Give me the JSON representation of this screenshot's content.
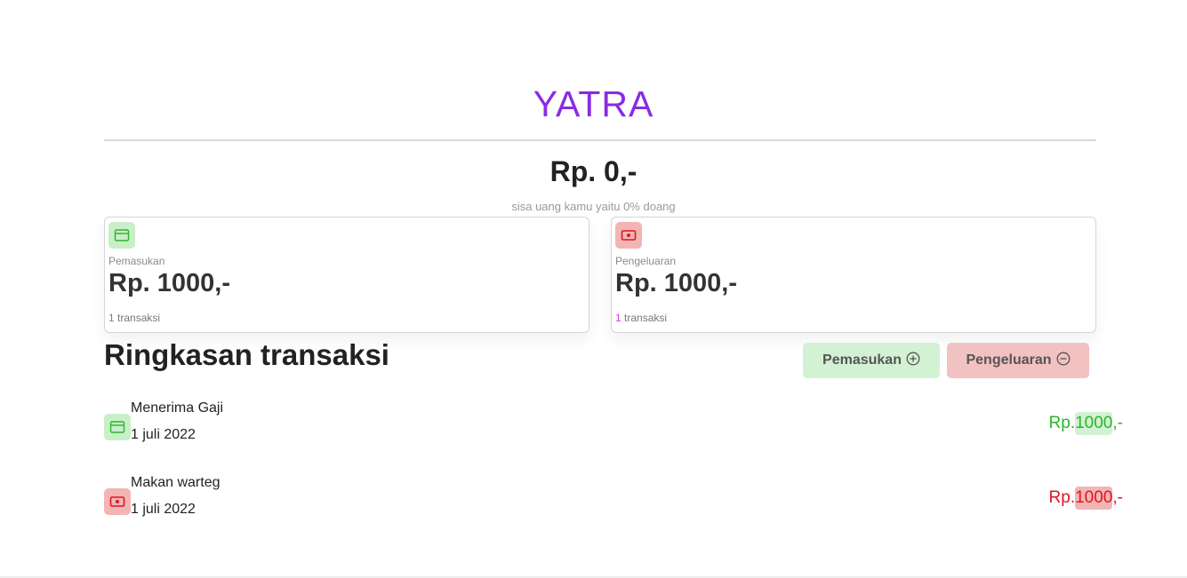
{
  "app": {
    "brand": "YATRA"
  },
  "summary": {
    "balance": "Rp. 0,-",
    "subtext": "sisa uang kamu yaitu 0% doang"
  },
  "cards": {
    "income": {
      "label": "Pemasukan",
      "amount": "Rp. 1000,-",
      "count": "1",
      "count_suffix": "transaksi",
      "icon": "wallet-icon"
    },
    "expense": {
      "label": "Pengeluaran",
      "amount": "Rp. 1000,-",
      "count": "1",
      "count_suffix": "transaksi",
      "icon": "cash-icon"
    }
  },
  "section": {
    "title": "Ringkasan transaksi"
  },
  "actions": {
    "add_income": "Pemasukan",
    "add_expense": "Pengeluaran"
  },
  "transactions": [
    {
      "name": "Menerima Gaji",
      "date": "1 juli 2022",
      "prefix": "Rp.",
      "amount": "1000",
      "suffix": ",-",
      "type": "income",
      "icon": "wallet-icon"
    },
    {
      "name": "Makan warteg",
      "date": "1 juli 2022",
      "prefix": "Rp.",
      "amount": "1000",
      "suffix": ",-",
      "type": "expense",
      "icon": "cash-icon"
    }
  ],
  "colors": {
    "brand": "#8a2be2",
    "income": "#2bb52b",
    "expense": "#e0141f",
    "income_bg": "#d3f1d3",
    "expense_bg": "#f3b4b4"
  }
}
